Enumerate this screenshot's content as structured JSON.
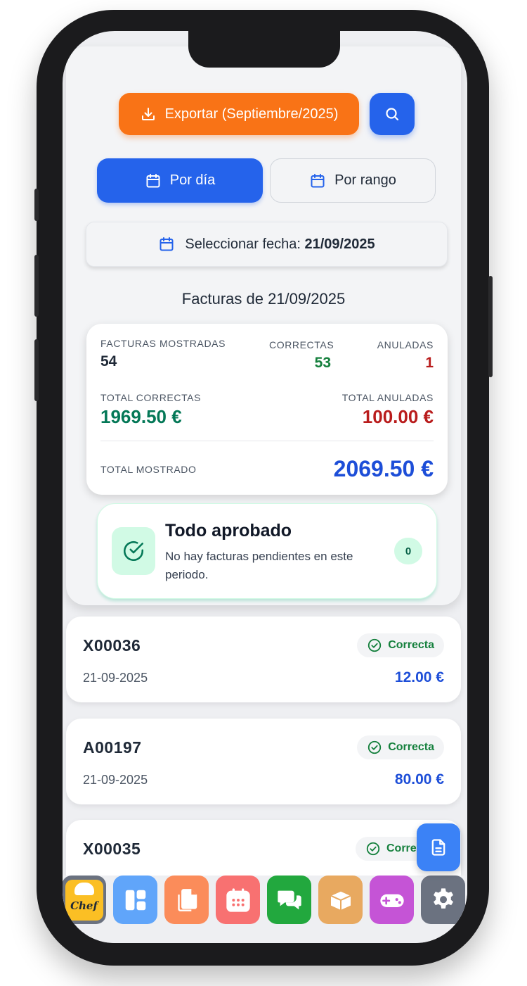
{
  "toolbar": {
    "export_label": "Exportar (Septiembre/2025)"
  },
  "mode_tabs": {
    "day_label": "Por día",
    "range_label": "Por rango"
  },
  "date_picker": {
    "prefix": "Seleccionar fecha:",
    "value": "21/09/2025"
  },
  "section_title": "Facturas de 21/09/2025",
  "summary": {
    "shown_label": "FACTURAS MOSTRADAS",
    "shown_value": "54",
    "correct_label": "CORRECTAS",
    "correct_value": "53",
    "voided_label": "ANULADAS",
    "voided_value": "1",
    "total_correct_label": "TOTAL CORRECTAS",
    "total_correct_value": "1969.50 €",
    "total_voided_label": "TOTAL ANULADAS",
    "total_voided_value": "100.00 €",
    "total_shown_label": "TOTAL MOSTRADO",
    "total_shown_value": "2069.50 €"
  },
  "approval": {
    "title": "Todo aprobado",
    "subtitle": "No hay facturas pendientes en este periodo.",
    "count": "0"
  },
  "invoices": [
    {
      "id": "X00036",
      "date": "21-09-2025",
      "amount": "12.00 €",
      "status": "Correcta"
    },
    {
      "id": "A00197",
      "date": "21-09-2025",
      "amount": "80.00 €",
      "status": "Correcta"
    },
    {
      "id": "X00035",
      "date": "",
      "amount": "",
      "status": "Corre"
    }
  ],
  "colors": {
    "primary": "#2563eb",
    "accent": "#f97316",
    "success": "#15803d",
    "danger": "#b91c1c"
  },
  "dock_apps": [
    "chef-logo-icon",
    "layout-icon",
    "copy-icon",
    "calendar-icon",
    "chat-icon",
    "box-icon",
    "gamepad-icon",
    "settings-icon"
  ],
  "dock_logo_text": "Chef"
}
